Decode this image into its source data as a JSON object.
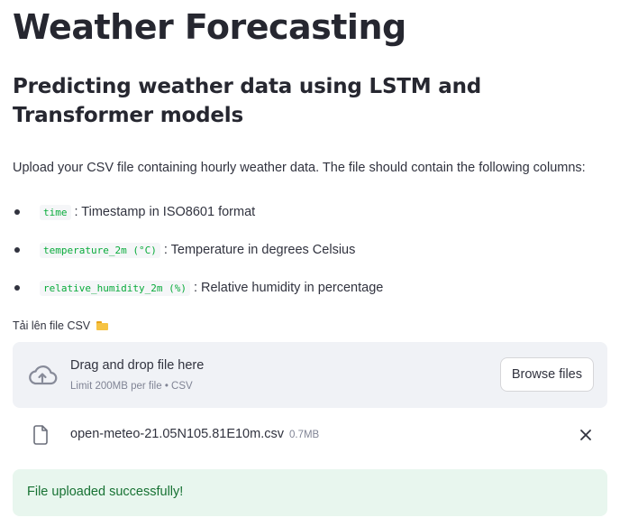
{
  "header": {
    "title": "Weather Forecasting",
    "subtitle": "Predicting weather data using LSTM and Transformer models"
  },
  "intro": "Upload your CSV file containing hourly weather data. The file should contain the following columns:",
  "columns": [
    {
      "code": "time",
      "description": ": Timestamp in ISO8601 format"
    },
    {
      "code": "temperature_2m (°C)",
      "description": ": Temperature in degrees Celsius"
    },
    {
      "code": "relative_humidity_2m (%)",
      "description": ": Relative humidity in percentage"
    }
  ],
  "uploader": {
    "label": "Tải lên file CSV",
    "label_icon": "folder-icon",
    "dropzone_title": "Drag and drop file here",
    "dropzone_hint": "Limit 200MB per file • CSV",
    "browse_label": "Browse files",
    "file": {
      "name": "open-meteo-21.05N105.81E10m.csv",
      "size": "0.7MB"
    }
  },
  "status": {
    "message": "File uploaded successfully!"
  },
  "colors": {
    "text": "#31333f",
    "code_green": "#09ab3b",
    "dropzone_bg": "#f0f2f6",
    "success_bg": "#e8f6ee",
    "success_text": "#177233"
  }
}
